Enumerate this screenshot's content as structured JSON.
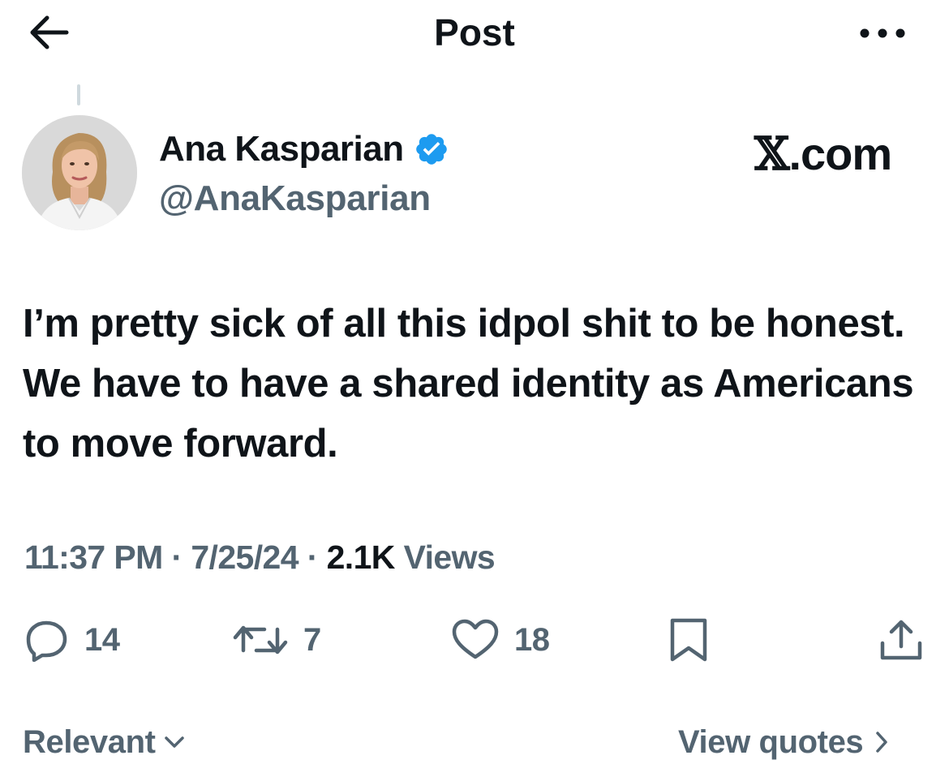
{
  "header": {
    "title": "Post",
    "back_icon": "arrow-left-icon",
    "more_icon": "more-horizontal-icon"
  },
  "author": {
    "display_name": "Ana Kasparian",
    "handle": "@AnaKasparian",
    "verified": true,
    "verified_color": "#1d9bf0"
  },
  "watermark": {
    "x_glyph": "𝕏",
    "domain": ".com"
  },
  "post": {
    "text": "I’m pretty sick of all this idpol shit to be honest. We have to have a shared identity as Americans to move forward."
  },
  "meta": {
    "time": "11:37 PM",
    "separator": " · ",
    "date": "7/25/24",
    "views_count": "2.1K",
    "views_label": " Views"
  },
  "actions": {
    "replies": "14",
    "reposts": "7",
    "likes": "18"
  },
  "footer": {
    "sort_label": "Relevant",
    "quotes_label": "View quotes"
  },
  "colors": {
    "text_primary": "#0f1419",
    "text_secondary": "#536471",
    "accent": "#1d9bf0",
    "divider": "#cfd9de"
  }
}
